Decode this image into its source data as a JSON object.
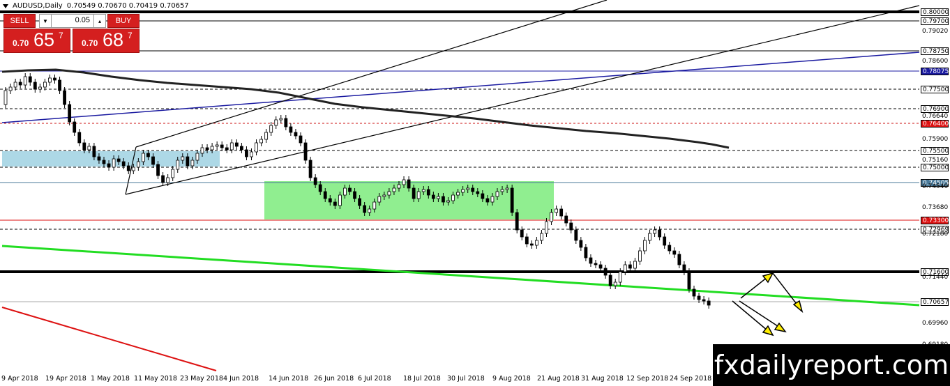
{
  "header": {
    "symbol": "AUDUSD,Daily",
    "ohlc": "0.70549 0.70670 0.70419 0.70657"
  },
  "trade_panel": {
    "sell_label": "SELL",
    "buy_label": "BUY",
    "lot_value": "0.05",
    "sell_prefix": "0.70",
    "sell_big": "65",
    "sell_sup": "7",
    "buy_prefix": "0.70",
    "buy_big": "68",
    "buy_sup": "7"
  },
  "price_scale": [
    "0.80000",
    "0.79700",
    "0.79020",
    "0.78750",
    "0.78600",
    "0.78075",
    "0.77500",
    "0.76900",
    "0.76640",
    "0.76400",
    "0.75900",
    "0.75500",
    "0.75160",
    "0.75000",
    "0.74505",
    "0.74540",
    "0.73680",
    "0.73300",
    "0.72969",
    "0.72180",
    "0.71600",
    "0.71440",
    "0.70657",
    "0.69960",
    "0.69180"
  ],
  "dates": [
    "9 Apr 2018",
    "19 Apr 2018",
    "1 May 2018",
    "11 May 2018",
    "23 May 2018",
    "4 Jun 2018",
    "14 Jun 2018",
    "26 Jun 2018",
    "6 Jul 2018",
    "18 Jul 2018",
    "30 Jul 2018",
    "9 Aug 2018",
    "21 Aug 2018",
    "31 Aug 2018",
    "12 Sep 2018",
    "24 Sep 2018"
  ],
  "watermark": "fxdailyreport.com",
  "colors": {
    "bull": "#ffffff",
    "bear": "#000000",
    "sell_buy": "#d41f1f",
    "green_zone": "#90ee90",
    "blue_zone": "#add8e6",
    "blue_line": "#1a1aa0",
    "green_line": "#22dd22",
    "red_line": "#dd1111",
    "arrow": "#ffee00"
  }
}
